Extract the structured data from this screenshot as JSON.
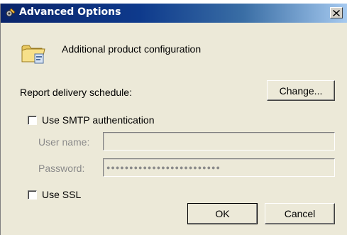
{
  "window": {
    "title": "Advanced Options",
    "icon": "options-gear-icon",
    "close_label": "×"
  },
  "header": {
    "description": "Additional product configuration",
    "icon": "folder-icon"
  },
  "schedule": {
    "label": "Report delivery schedule:",
    "change_button": "Change..."
  },
  "smtp": {
    "checkbox_label": "Use SMTP authentication",
    "checked": false,
    "username_label": "User name:",
    "username_value": "",
    "password_label": "Password:",
    "password_value": "●●●●●●●●●●●●●●●●●●●●●●●●●"
  },
  "ssl": {
    "checkbox_label": "Use SSL",
    "checked": false
  },
  "footer": {
    "ok_label": "OK",
    "cancel_label": "Cancel"
  }
}
